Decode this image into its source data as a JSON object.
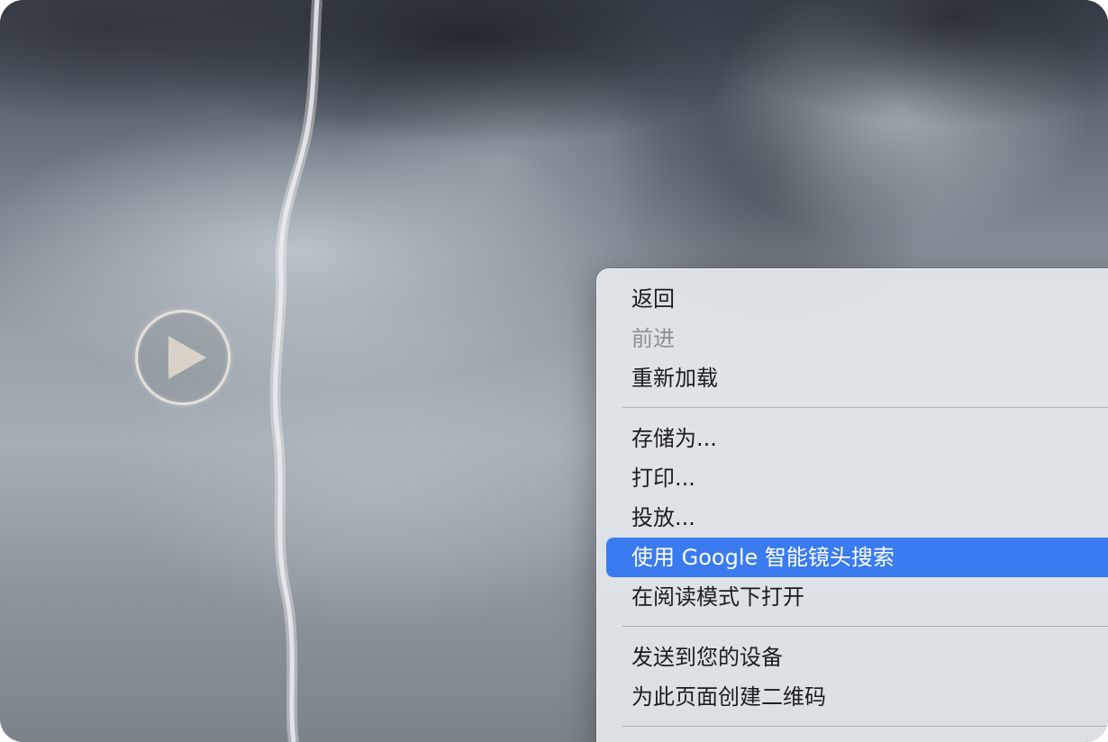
{
  "video": {
    "play_icon": "play-icon"
  },
  "context_menu": {
    "groups": [
      {
        "items": [
          {
            "label": "返回",
            "enabled": true
          },
          {
            "label": "前进",
            "enabled": false
          },
          {
            "label": "重新加载",
            "enabled": true
          }
        ]
      },
      {
        "items": [
          {
            "label": "存储为...",
            "enabled": true
          },
          {
            "label": "打印...",
            "enabled": true
          },
          {
            "label": "投放...",
            "enabled": true
          },
          {
            "label": "使用 Google 智能镜头搜索",
            "enabled": true,
            "highlighted": true
          },
          {
            "label": "在阅读模式下打开",
            "enabled": true
          }
        ]
      },
      {
        "items": [
          {
            "label": "发送到您的设备",
            "enabled": true
          },
          {
            "label": "为此页面创建二维码",
            "enabled": true
          }
        ]
      }
    ],
    "highlight_color": "#3a7bf0"
  }
}
